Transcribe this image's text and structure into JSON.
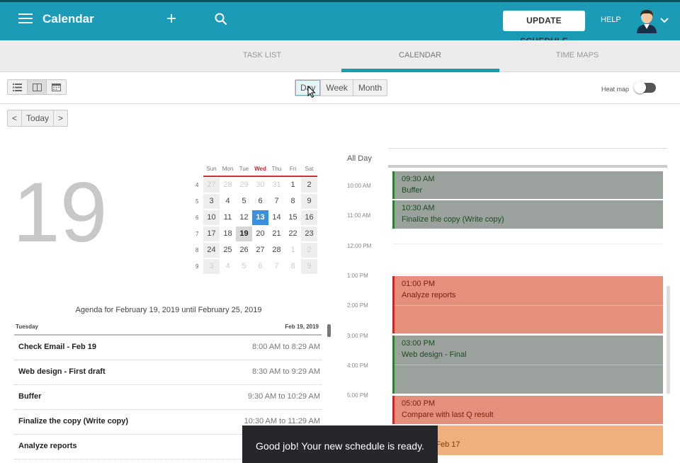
{
  "header": {
    "title": "Calendar",
    "update_label": "UPDATE SCHEDULE",
    "help_label": "HELP"
  },
  "tabs": [
    {
      "label": "TASK LIST"
    },
    {
      "label": "CALENDAR"
    },
    {
      "label": "TIME MAPS"
    }
  ],
  "toolbar": {
    "range_buttons": [
      "Day",
      "Week",
      "Month"
    ],
    "heatmap_label": "Heat map",
    "heatmap_on": false
  },
  "nav": {
    "prev": "<",
    "today": "Today",
    "next": ">"
  },
  "big_date": "19",
  "mini_calendar": {
    "weekdays": [
      "Sun",
      "Mon",
      "Tue",
      "Wed",
      "Thu",
      "Fri",
      "Sat"
    ],
    "weeks": [
      {
        "wk": "4",
        "days": [
          "27",
          "28",
          "29",
          "30",
          "31",
          "1",
          "2"
        ]
      },
      {
        "wk": "5",
        "days": [
          "3",
          "4",
          "5",
          "6",
          "7",
          "8",
          "9"
        ]
      },
      {
        "wk": "6",
        "days": [
          "10",
          "11",
          "12",
          "13",
          "14",
          "15",
          "16"
        ]
      },
      {
        "wk": "7",
        "days": [
          "17",
          "18",
          "19",
          "20",
          "21",
          "22",
          "23"
        ]
      },
      {
        "wk": "8",
        "days": [
          "24",
          "25",
          "26",
          "27",
          "28",
          "1",
          "2"
        ]
      },
      {
        "wk": "9",
        "days": [
          "3",
          "4",
          "5",
          "6",
          "7",
          "8",
          "9"
        ]
      }
    ]
  },
  "agenda": {
    "title": "Agenda for February 19, 2019 until February 25, 2019",
    "day_label": "Tuesday",
    "date_label": "Feb 19, 2019",
    "items": [
      {
        "title": "Check Email - Feb  19",
        "time": "8:00 AM to 8:29 AM"
      },
      {
        "title": "Web design - First draft",
        "time": "8:30 AM to 9:29 AM"
      },
      {
        "title": "Buffer",
        "time": "9:30 AM to 10:29 AM"
      },
      {
        "title": "Finalize the copy (Write copy)",
        "time": "10:30 AM to 11:29 AM"
      },
      {
        "title": "Analyze reports",
        "time": ""
      }
    ]
  },
  "day_view": {
    "all_day_label": "All Day",
    "hours": [
      "10:00 AM",
      "11:00 AM",
      "12:00 PM",
      "1:00 PM",
      "2:00 PM",
      "3:00 PM",
      "4:00 PM",
      "5:00 PM"
    ],
    "events": [
      {
        "time": "09:30 AM",
        "title": "Buffer",
        "color": "gray"
      },
      {
        "time": "10:30 AM",
        "title": "Finalize the copy (Write copy)",
        "color": "gray"
      },
      {
        "time": "01:00 PM",
        "title": "Analyze reports",
        "color": "red"
      },
      {
        "time": "03:00 PM",
        "title": "Web design - Final",
        "color": "gray"
      },
      {
        "time": "05:00 PM",
        "title": "Compare with last Q result",
        "color": "red"
      },
      {
        "time": "",
        "title": "ode - w/o Feb  17",
        "color": "orange"
      }
    ]
  },
  "toast": {
    "message": "Good job! Your new schedule is ready."
  },
  "colors": {
    "brand": "#1b9bb5",
    "event_gray": "#9ba29e",
    "event_red": "#e5907a",
    "event_orange": "#f0b07d"
  }
}
